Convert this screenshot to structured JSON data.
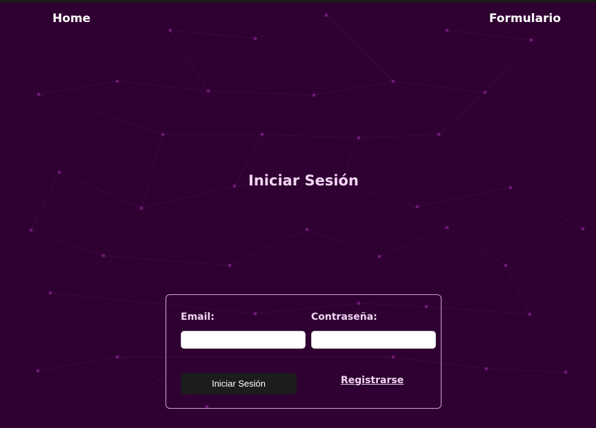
{
  "nav": {
    "home_label": "Home",
    "form_label": "Formulario"
  },
  "page": {
    "title": "Iniciar Sesión"
  },
  "login_form": {
    "email_label": "Email:",
    "email_value": "",
    "password_label": "Contraseña:",
    "password_value": "",
    "submit_label": "Iniciar Sesión",
    "register_label": "Registrarse"
  },
  "colors": {
    "background": "#2f0032",
    "node": "#7a1f80",
    "line": "#4a0c50",
    "text_light": "#f1d7f2",
    "button": "#1c1c1c"
  }
}
